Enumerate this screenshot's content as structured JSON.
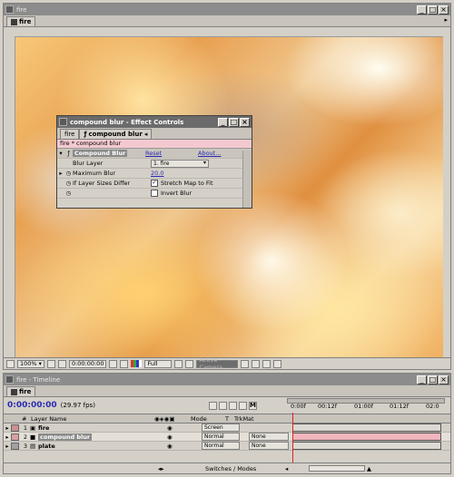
{
  "comp_window": {
    "title": "fire",
    "tab_label": "fire",
    "toolbar": {
      "zoom": "100%",
      "timecode": "0:00:00:00",
      "resolution": "Full",
      "camera": "Active Camera"
    }
  },
  "effect_controls": {
    "title": "compound blur - Effect Controls",
    "tabs": [
      "fire",
      "compound blur"
    ],
    "breadcrumb": "fire * compound blur",
    "effect_name": "Compound Blur",
    "reset_label": "Reset",
    "about_label": "About...",
    "rows": [
      {
        "label": "Blur Layer",
        "value": "1. fire"
      },
      {
        "label": "Maximum Blur",
        "value": "20.0"
      },
      {
        "label": "If Layer Sizes Differ",
        "value": "Stretch Map to Fit"
      },
      {
        "label": "",
        "value": "Invert Blur"
      }
    ]
  },
  "timeline": {
    "title": "fire - Timeline",
    "tab_label": "fire",
    "timecode": "0:00:00:00",
    "fps": "(29.97 fps)",
    "ruler": [
      "0:00f",
      "00:12f",
      "01:00f",
      "01:12f",
      "02:0"
    ],
    "headers": {
      "num": "#",
      "layer_name": "Layer Name",
      "mode": "Mode",
      "t": "T",
      "trkmat": "TrkMat"
    },
    "layers": [
      {
        "num": "1",
        "name": "fire",
        "mode": "Screen",
        "trkmat": "",
        "label_color": "#c98f8f",
        "bar_color": "#dcd9d2"
      },
      {
        "num": "2",
        "name": "compound blur",
        "mode": "Normal",
        "trkmat": "None",
        "label_color": "#d7a0a0",
        "bar_color": "#f0b6bc"
      },
      {
        "num": "3",
        "name": "plate",
        "mode": "Normal",
        "trkmat": "None",
        "label_color": "#a0a0a0",
        "bar_color": "#dcd9d2"
      }
    ],
    "bottom_label": "Switches / Modes"
  }
}
